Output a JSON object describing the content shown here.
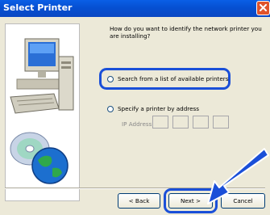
{
  "window": {
    "title": "Select Printer"
  },
  "question": "How do you want to identify the network printer you are installing?",
  "options": [
    {
      "label": "Search from a list of available printers",
      "selected": true
    },
    {
      "label": "Specify a printer by address",
      "selected": false
    }
  ],
  "ip_address": {
    "label": "IP Address",
    "octets": [
      "",
      "",
      "",
      ""
    ]
  },
  "buttons": {
    "back": "< Back",
    "next": "Next >",
    "cancel": "Cancel"
  },
  "colors": {
    "titlebar": "#0650d2",
    "highlight": "#1a4fd8",
    "window_bg": "#ece9d8",
    "close": "#e0532c"
  },
  "icons": [
    "close-icon",
    "computer-illustration-icon",
    "cd-disc-icon",
    "globe-icon",
    "pointer-arrow-icon"
  ]
}
